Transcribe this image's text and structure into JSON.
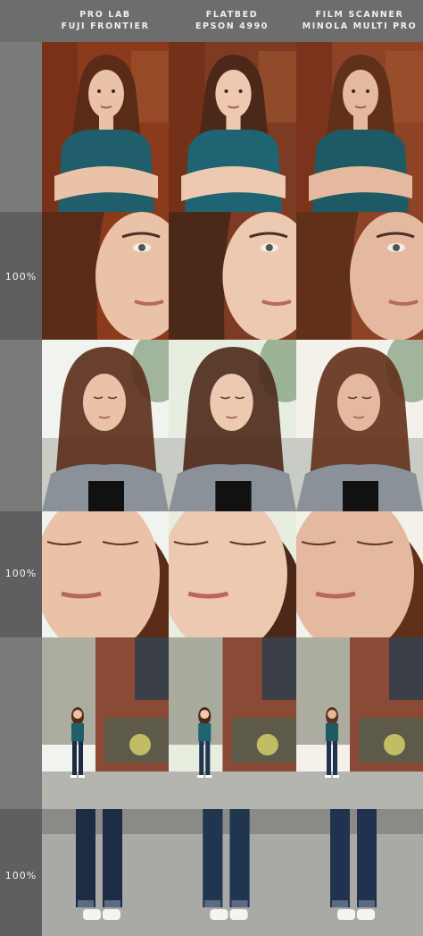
{
  "columns": [
    {
      "line1": "PRO LAB",
      "line2": "FUJI FRONTIER"
    },
    {
      "line1": "FLATBED",
      "line2": "EPSON 4990"
    },
    {
      "line1": "FILM SCANNER",
      "line2": "MINOLA MULTI PRO"
    }
  ],
  "row_labels": [
    "",
    "100%",
    "",
    "100%",
    "",
    "100%"
  ],
  "photos": {
    "row1": "portrait-woman-arms-crossed-rust-wall",
    "row2": "portrait-crop-100-percent",
    "row3": "woman-eyes-closed-curly-hair",
    "row4": "face-crop-100-percent",
    "row5": "woman-standing-street-graffiti",
    "row6": "legs-jeans-crop-100-percent"
  },
  "colors": {
    "header_bg": "#6d6d6d",
    "band_dark": "#5f5f5f",
    "band_light": "#7a7a7a",
    "text": "#efefef"
  }
}
